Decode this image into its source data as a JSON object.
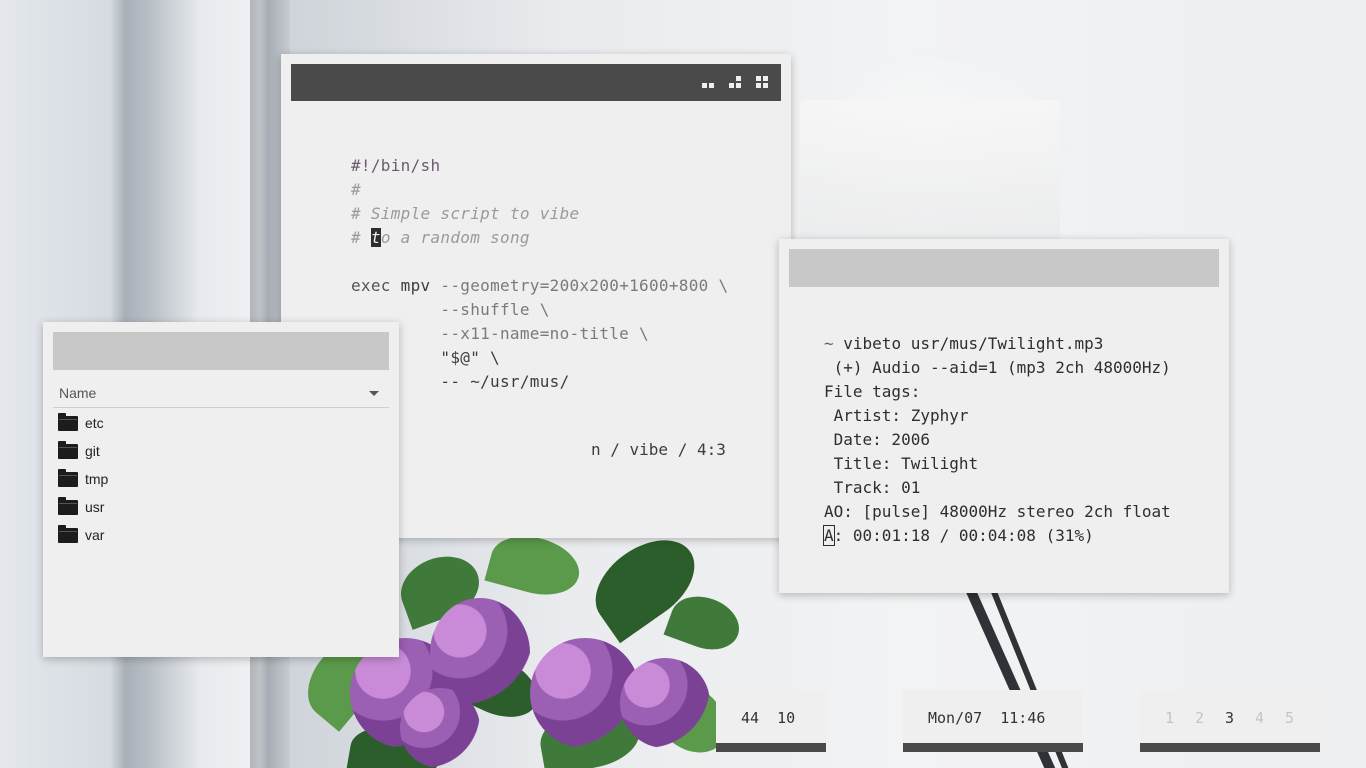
{
  "editor": {
    "title_buttons": [
      "minimize-icon",
      "tile-icon",
      "grid-icon"
    ],
    "lines": {
      "l1": "#!/bin/sh",
      "l2": "#",
      "l3": "# Simple script to vibe",
      "l4_prefix": "# ",
      "l4_cursor": "t",
      "l4_rest": "o a random song",
      "l6_exec": "exec",
      "l6_mpv": " mpv ",
      "l6_opt": "--geometry=200x200+1600+800 \\",
      "l7": "         --shuffle \\",
      "l8": "         --x11-name=no-title \\",
      "l9": "         \"$@\" \\",
      "l10": "         -- ~/usr/mus/"
    },
    "status": "n / vibe / 4:3"
  },
  "files": {
    "column_header": "Name",
    "items": [
      {
        "name": "etc"
      },
      {
        "name": "git"
      },
      {
        "name": "tmp"
      },
      {
        "name": "usr"
      },
      {
        "name": "var"
      }
    ]
  },
  "terminal": {
    "prompt": "~",
    "command": " vibeto usr/mus/Twilight.mp3",
    "lines": [
      " (+) Audio --aid=1 (mp3 2ch 48000Hz)",
      "File tags:",
      " Artist: Zyphyr",
      " Date: 2006",
      " Title: Twilight",
      " Track: 01",
      "AO: [pulse] 48000Hz stereo 2ch float"
    ],
    "progress_cursor": "A",
    "progress_rest": ": 00:01:18 / 00:04:08 (31%)"
  },
  "bars": {
    "sys": "44  10",
    "clock": "Mon/07  11:46",
    "workspaces": [
      "1",
      "2",
      "3",
      "4",
      "5"
    ],
    "active_workspace": "3"
  },
  "colors": {
    "titlebar_dark": "#4a4a4a",
    "titlebar_light": "#c8c8c8",
    "window_bg": "#efefef"
  }
}
